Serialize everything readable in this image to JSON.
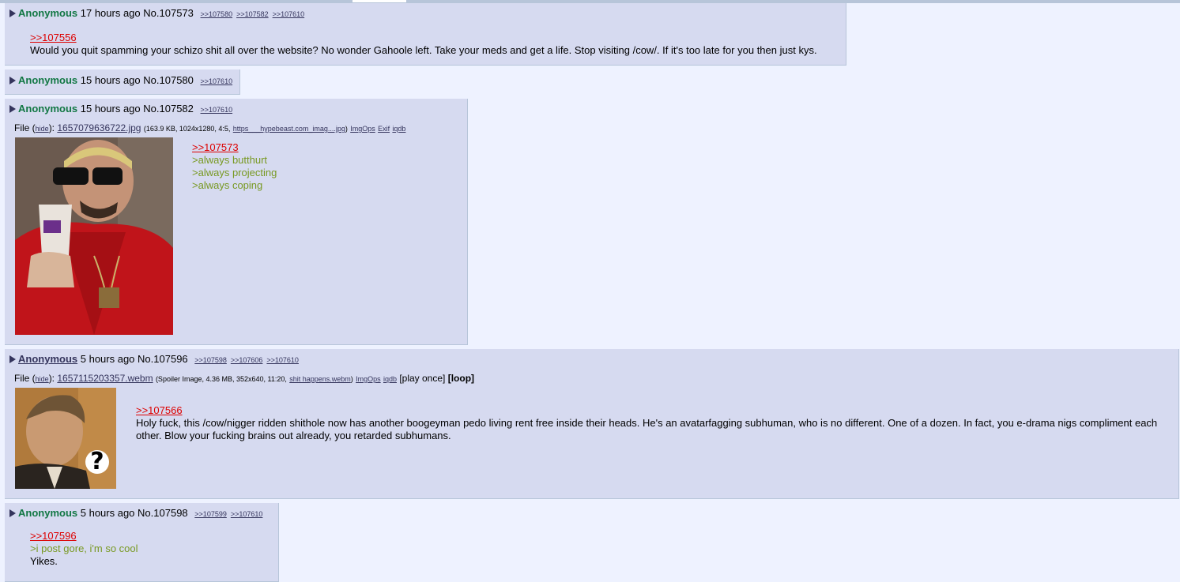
{
  "posts": [
    {
      "name": "Anonymous",
      "time": "17 hours ago",
      "no": "No.107573",
      "backlinks": [
        ">>107580",
        ">>107582",
        ">>107610"
      ],
      "lines": [
        ">>107556",
        "Would you quit spamming your schizo shit all over the website? No wonder Gahoole left. Take your meds and get a life. Stop visiting /cow/. If it's too late for you then just kys."
      ]
    },
    {
      "name": "Anonymous",
      "time": "15 hours ago",
      "no": "No.107580",
      "backlinks": [
        ">>107610"
      ]
    },
    {
      "name": "Anonymous",
      "time": "15 hours ago",
      "no": "No.107582",
      "backlinks": [
        ">>107610"
      ],
      "file": {
        "prefix": "File (",
        "hide": "hide",
        "after_hide": "):",
        "filename": "1657079636722.jpg",
        "meta_open": "(163.9 KB, 1024x1280, 4:5,",
        "source": "https___hypebeast.com_imag....jpg",
        "meta_close": ")",
        "links": [
          "ImgOps",
          "Exif",
          "iqdb"
        ]
      },
      "lines": [
        ">>107573",
        ">always butthurt",
        ">always projecting",
        ">always coping"
      ]
    },
    {
      "name": "Anonymous",
      "time": "5 hours ago",
      "no": "No.107596",
      "backlinks": [
        ">>107598",
        ">>107606",
        ">>107610"
      ],
      "file": {
        "prefix": "File (",
        "hide": "hide",
        "after_hide": "):",
        "filename": "1657115203357.webm",
        "meta_open": "(Spoiler Image, 4.36 MB, 352x640, 11:20,",
        "source": "shit happens.webm",
        "meta_close": ")",
        "links": [
          "ImgOps",
          "iqdb"
        ],
        "play_once": "[play once]",
        "loop": "[loop]"
      },
      "lines": [
        ">>107566",
        "Holy fuck, this /cow/nigger ridden shithole now has another boogeyman pedo living rent free inside their heads. He's an avatarfagging subhuman, who is no different. One of a dozen. In fact, you e-drama nigs compliment each",
        "other. Blow your fucking brains out already, you retarded subhumans."
      ],
      "thumb_mark": "?"
    },
    {
      "name": "Anonymous",
      "time": "5 hours ago",
      "no": "No.107598",
      "backlinks": [
        ">>107599",
        ">>107610"
      ],
      "lines": [
        ">>107596",
        ">i post gore, i'm so cool",
        "Yikes."
      ]
    }
  ],
  "colors": {
    "page_bg": "#eef2ff",
    "post_bg": "#d6daf0",
    "name": "#117743",
    "link": "#34345c",
    "quotelink": "#dd0000",
    "greentext": "#789922"
  }
}
